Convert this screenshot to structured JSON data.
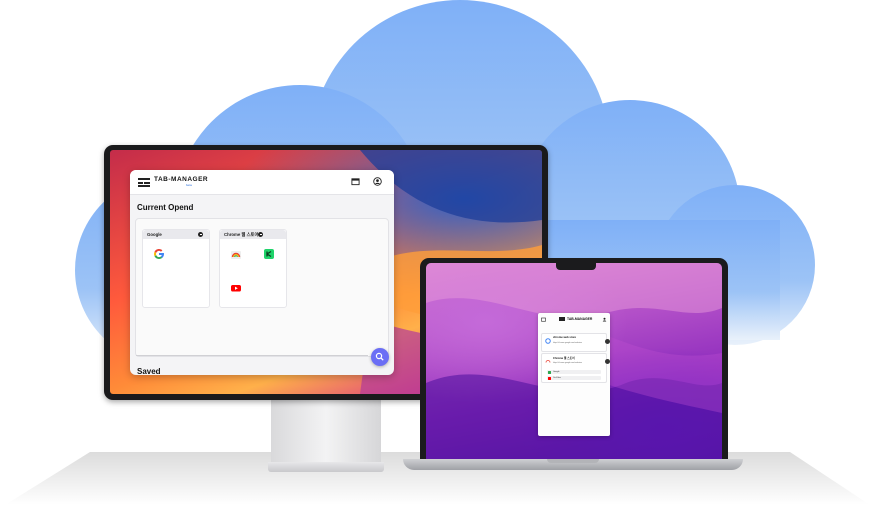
{
  "desktop_app": {
    "brand": "TAB-MANAGER",
    "brand_sub": "beta",
    "section_current": "Current Opend",
    "section_saved": "Saved",
    "groups": [
      {
        "title": "Google"
      },
      {
        "title": "Chrome 웹 스토어"
      }
    ],
    "header_icons": [
      "window-icon",
      "profile-icon"
    ],
    "search_icon": "search-icon"
  },
  "laptop_popup": {
    "brand": "TAB-MANAGER",
    "cards": [
      {
        "title": "chrome web store",
        "subtitle": "https://chrome.google.com/webstore"
      },
      {
        "title": "Chrome 웹 스토어",
        "subtitle": "https://chrome.google.com/webstore"
      }
    ],
    "items": [
      {
        "label": "Google",
        "color": "#2fa84f"
      },
      {
        "label": "YouTube",
        "color": "#ff0000"
      }
    ]
  },
  "colors": {
    "cloud": "#8ab8f5",
    "accent": "#6b6ef5"
  }
}
